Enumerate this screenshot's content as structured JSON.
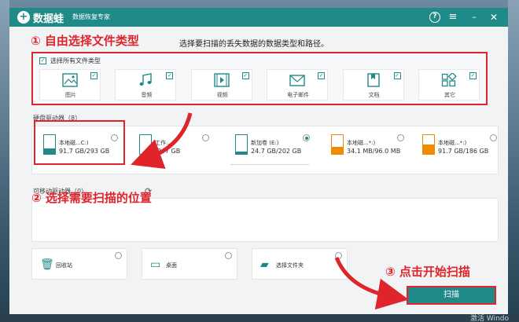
{
  "app": {
    "logo_mark": "+",
    "logo_text": "数据蛙",
    "subtitle": "数据恢复专家",
    "controls": {
      "help": "?",
      "menu": "≡",
      "minimize": "–",
      "close": "✕"
    }
  },
  "annotations": {
    "step1": "① 自由选择文件类型",
    "step2": "② 选择需要扫描的位置",
    "step3": "③ 点击开始扫描"
  },
  "hint": "选择要扫描的丢失数据的数据类型和路径。",
  "file_types": {
    "select_all_label": "选择所有文件类型",
    "items": [
      {
        "label": "图片",
        "icon": "image-icon",
        "checked": true
      },
      {
        "label": "音频",
        "icon": "music-icon",
        "checked": true
      },
      {
        "label": "视频",
        "icon": "video-icon",
        "checked": true
      },
      {
        "label": "电子邮件",
        "icon": "mail-icon",
        "checked": true
      },
      {
        "label": "文档",
        "icon": "document-icon",
        "checked": true
      },
      {
        "label": "其它",
        "icon": "other-icon",
        "checked": true
      }
    ]
  },
  "hard_drives": {
    "label": "硬盘驱动器（8）",
    "items": [
      {
        "name": "本地磁...C:)",
        "size": "91.7 GB/293 GB",
        "fill_color": "#208a88",
        "used_fraction": 0.31,
        "selected": false
      },
      {
        "name": "工作...",
        "size": "/247 GB",
        "fill_color": "#208a88",
        "used_fraction": 0.0,
        "selected": false
      },
      {
        "name": "新加卷 (E:)",
        "size": "24.7 GB/202 GB",
        "fill_color": "#208a88",
        "used_fraction": 0.12,
        "selected": true
      },
      {
        "name": "本地磁...*:)",
        "size": "34.1 MB/96.0 MB",
        "fill_color": "#f08a00",
        "used_fraction": 0.36,
        "selected": false
      },
      {
        "name": "本地磁...*:)",
        "size": "91.7 GB/186 GB",
        "fill_color": "#f08a00",
        "used_fraction": 0.49,
        "selected": false
      }
    ]
  },
  "removable": {
    "label": "可移动驱动器（0）",
    "refresh_icon": "refresh-icon"
  },
  "locations": [
    {
      "label": "回收站",
      "icon": "trash-icon"
    },
    {
      "label": "桌面",
      "icon": "desktop-icon"
    },
    {
      "label": "选择文件夹",
      "icon": "folder-icon"
    }
  ],
  "scan_button": "扫描",
  "watermark": "激活 Windo",
  "colors": {
    "accent": "#208a88",
    "annotation": "#e0242b",
    "warn": "#f08a00"
  }
}
